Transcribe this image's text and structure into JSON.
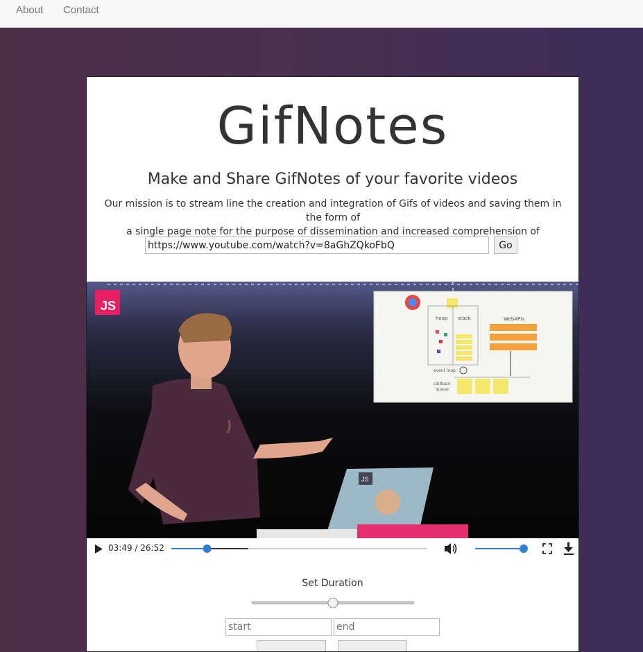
{
  "nav": {
    "about": "About",
    "contact": "Contact"
  },
  "header": {
    "title": "GifNotes",
    "subtitle": "Make and Share GifNotes of your favorite videos",
    "mission_line1": "Our mission is to stream line the creation and integration of Gifs of videos and saving them in the form of",
    "mission_line2": "a single page note for the purpose of dissemination and increased comprehension of knowledge."
  },
  "url_form": {
    "value": "https://www.youtube.com/watch?v=8aGhZQkoFbQ",
    "go_label": "Go"
  },
  "video": {
    "logo_text": "JS",
    "slide_heap": "heap",
    "slide_stack": "stack",
    "slide_webapis": "WebAPIs",
    "slide_event_loop": "event loop",
    "slide_callback": "callback",
    "slide_queue": "queue",
    "laptop_badge": "JS",
    "current_time": "03:49",
    "total_time": "26:52",
    "time_display": "03:49 / 26:52",
    "progress": 0.14,
    "buffered": 0.3,
    "volume": 1.0
  },
  "duration": {
    "label": "Set Duration",
    "slider_value": 0.5,
    "start_placeholder": "start",
    "end_placeholder": "end"
  },
  "colors": {
    "accent": "#2e7fd6",
    "js_pink": "#e91e63",
    "slide_orange": "#f5a03a",
    "slide_yellow": "#f4e86b"
  }
}
